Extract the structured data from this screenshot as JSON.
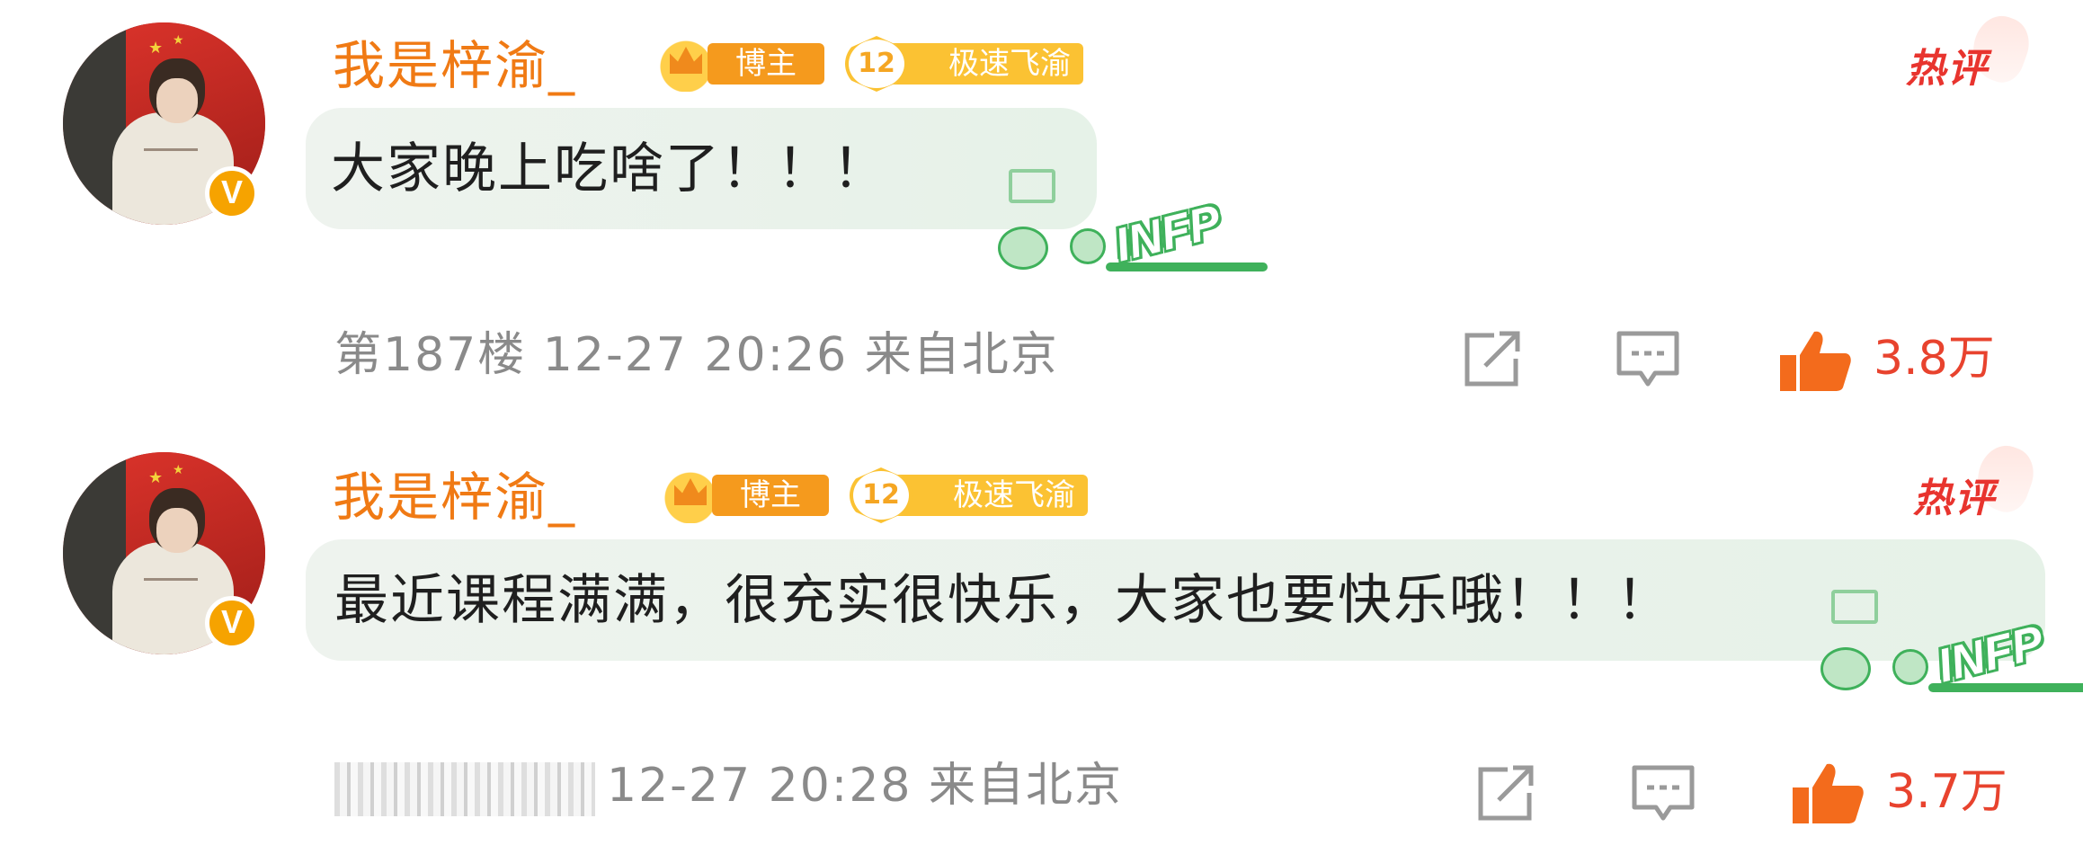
{
  "comments": [
    {
      "username": "我是梓渝_",
      "badge_blogger": "博主",
      "badge_level": "12",
      "badge_fan_group": "极速飞渝",
      "hot_label": "热评",
      "text": "大家晚上吃啥了！！！",
      "sticker_label": "INFP",
      "meta": "第187楼 12-27 20:26 来自北京",
      "likes": "3.8万",
      "avatar_badge": "V"
    },
    {
      "username": "我是梓渝_",
      "badge_blogger": "博主",
      "badge_level": "12",
      "badge_fan_group": "极速飞渝",
      "hot_label": "热评",
      "text": "最近课程满满，很充实很快乐，大家也要快乐哦！！！",
      "sticker_label": "INFP",
      "meta": "12-27 20:28 来自北京",
      "likes": "3.7万",
      "avatar_badge": "V"
    }
  ],
  "icons": {
    "share": "share-icon",
    "comment": "comment-icon",
    "like": "thumbs-up-icon"
  },
  "colors": {
    "username": "#f07a14",
    "hot": "#e8342e",
    "likes": "#e8432e",
    "bubble": "#e9f3ea",
    "meta": "#8a8a8a"
  }
}
